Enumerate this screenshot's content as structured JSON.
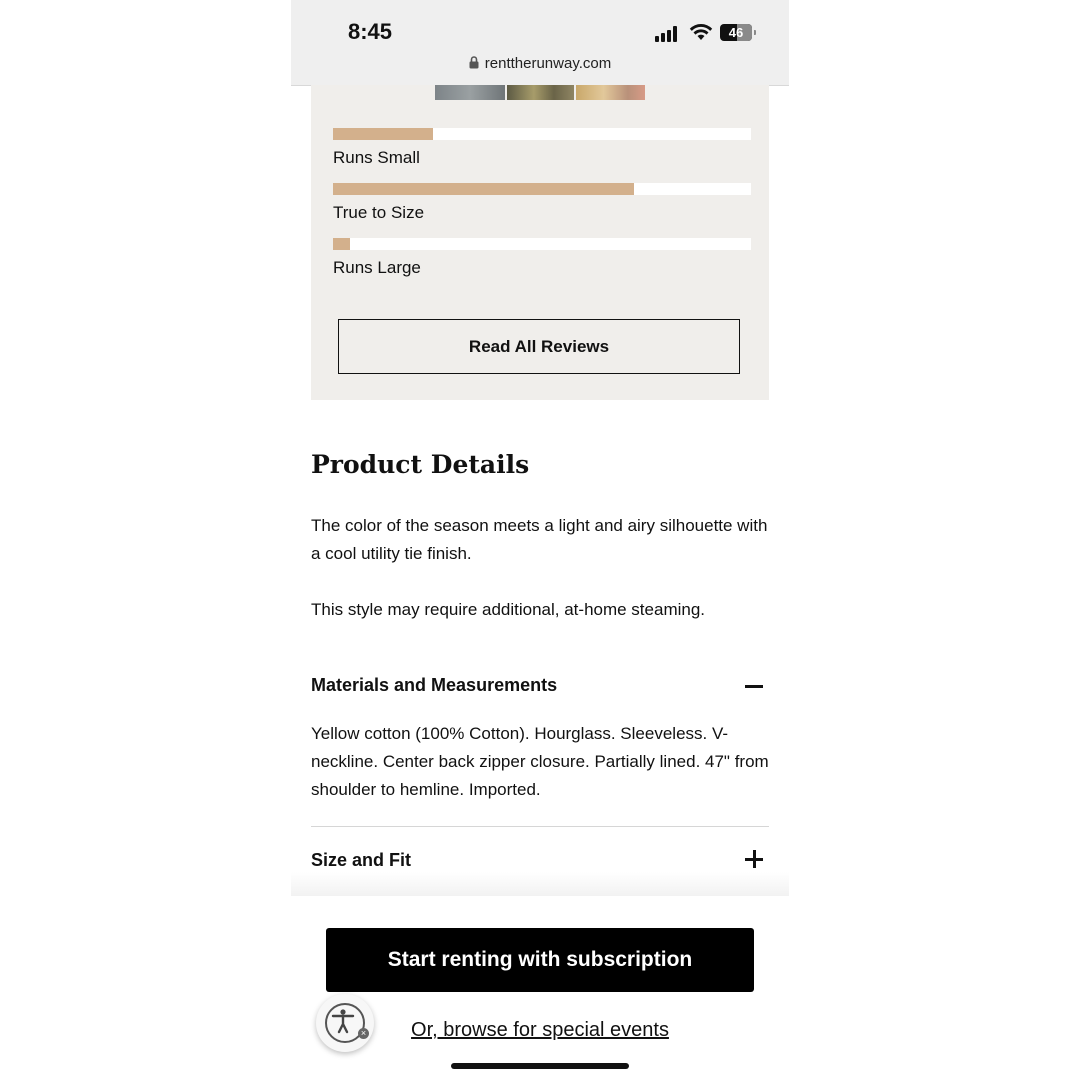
{
  "browser": {
    "time": "8:45",
    "battery_level": "46",
    "battery_percent": 46,
    "url": "renttherunway.com",
    "icons": [
      "signal-icon",
      "wifi-icon",
      "battery-icon",
      "lock-icon"
    ]
  },
  "reviews": {
    "fit_bars": [
      {
        "label": "Runs Small",
        "fraction": 0.24
      },
      {
        "label": "True to Size",
        "fraction": 0.72
      },
      {
        "label": "Runs Large",
        "fraction": 0.04
      }
    ],
    "read_all_label": "Read All Reviews"
  },
  "product": {
    "title": "Product Details",
    "description": "The color of the season meets a light and airy silhouette with a cool utility tie finish.",
    "note": "This style may require additional, at-home steaming.",
    "materials": {
      "title": "Materials and Measurements",
      "body": "Yellow cotton (100% Cotton). Hourglass. Sleeveless. V-neckline. Center back zipper closure. Partially lined. 47\" from shoulder to hemline. Imported."
    },
    "size_fit": {
      "title": "Size and Fit"
    }
  },
  "cta": {
    "primary_label": "Start renting with subscription",
    "secondary_label": "Or, browse for special events"
  },
  "colors": {
    "accent_tan": "#d3b08c",
    "panel_bg": "#f0eeeb",
    "cta_bg": "#000000"
  }
}
